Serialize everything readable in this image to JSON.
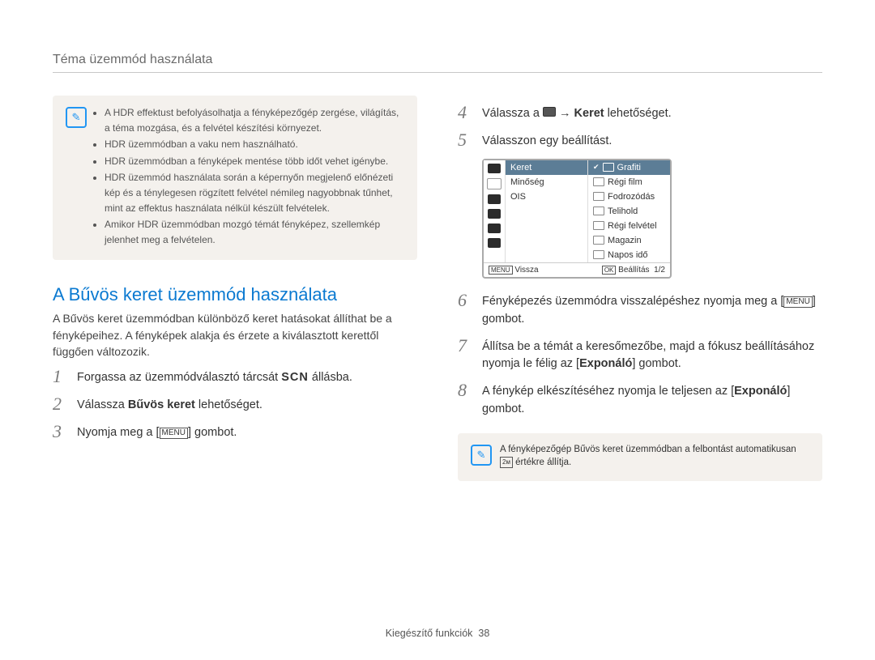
{
  "header": {
    "text": "Téma üzemmód használata"
  },
  "left": {
    "notes": [
      "A HDR effektust befolyásolhatja a fényképezőgép zergése, világítás, a téma mozgása, és a felvétel készítési környezet.",
      "HDR üzemmódban a vaku nem használható.",
      "HDR üzemmódban a fényképek mentése több időt vehet igénybe.",
      "HDR üzemmód használata során a képernyőn megjelenő előnézeti kép és a ténylegesen rögzített felvétel némileg nagyobbnak tűnhet, mint az effektus használata nélkül készült felvételek.",
      "Amikor HDR üzemmódban mozgó témát fényképez, szellemkép jelenhet meg a felvételen."
    ],
    "heading": "A Bűvös keret üzemmód használata",
    "intro": "A Bűvös keret üzemmódban különböző keret hatásokat állíthat be a fényképeihez. A fényképek alakja és érzete a kiválasztott kerettől függően változozik.",
    "steps": [
      {
        "n": "1",
        "pre": "Forgassa az üzemmódválasztó tárcsát ",
        "scn": "SCN",
        "post": " állásba."
      },
      {
        "n": "2",
        "pre": "Válassza ",
        "bold": "Bűvös keret",
        "post": " lehetőséget."
      },
      {
        "n": "3",
        "pre": "Nyomja meg a [",
        "menu": "MENU",
        "post": "] gombot."
      }
    ]
  },
  "right": {
    "step4_pre": "Válassza a ",
    "step4_bold": "Keret",
    "step4_post": " lehetőséget.",
    "step5": "Válasszon egy beállítást.",
    "lcd": {
      "leftcol": [
        "Keret",
        "Minőség",
        "OIS"
      ],
      "rightcol": [
        "Grafiti",
        "Régi film",
        "Fodrozódás",
        "Telihold",
        "Régi felvétel",
        "Magazin",
        "Napos idő"
      ],
      "back": "Vissza",
      "set": "Beállítás",
      "page": "1/2",
      "menu": "MENU",
      "ok": "OK"
    },
    "step6_pre": "Fényképezés üzemmódra visszalépéshez nyomja meg a [",
    "step6_menu": "MENU",
    "step6_post": "] gombot.",
    "step7_a": "Állítsa be a témát a keresőmezőbe, majd a fókusz beállításához nyomja le félig az [",
    "step7_b": "Exponáló",
    "step7_c": "] gombot.",
    "step8_a": "A fénykép elkészítéséhez nyomja le teljesen az [",
    "step8_b": "Exponáló",
    "step8_c": "] gombot.",
    "bottom_note_a": "A fényképezőgép Bűvös keret üzemmódban a felbontást automatikusan ",
    "bottom_note_b": " értékre állítja."
  },
  "footer": {
    "label": "Kiegészítő funkciók",
    "num": "38"
  }
}
